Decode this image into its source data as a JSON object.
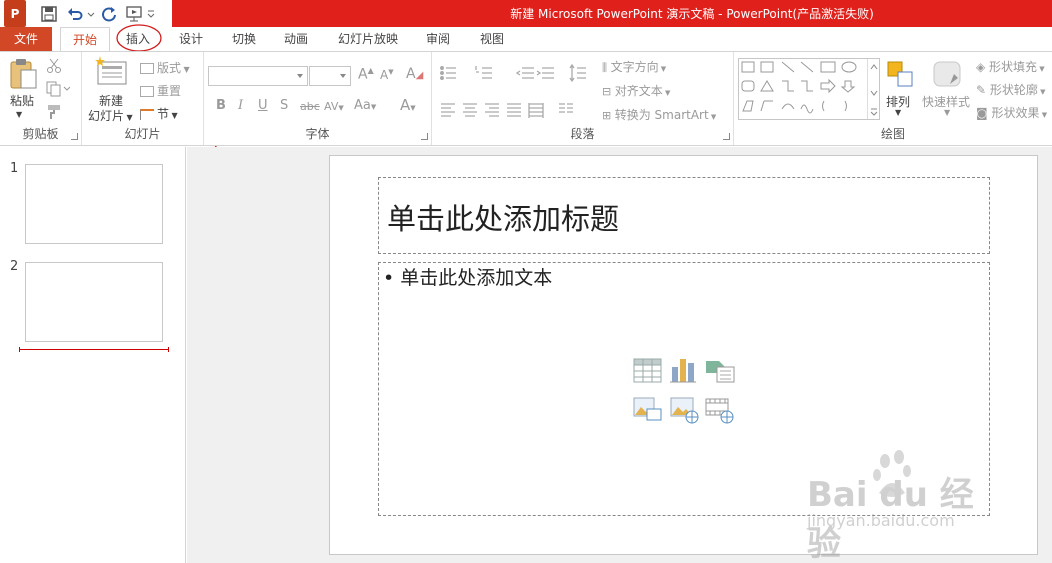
{
  "window": {
    "title": "新建 Microsoft PowerPoint 演示文稿 -  PowerPoint(产品激活失败)",
    "logo_letter": "P",
    "title_bar_color": "#e0201b"
  },
  "tabs": {
    "file": "文件",
    "home": "开始",
    "insert": "插入",
    "design": "设计",
    "transitions": "切换",
    "animations": "动画",
    "slideshow": "幻灯片放映",
    "review": "审阅",
    "view": "视图"
  },
  "ribbon": {
    "clipboard": {
      "label": "剪贴板",
      "paste": "粘贴"
    },
    "slides": {
      "label": "幻灯片",
      "new_slide_line1": "新建",
      "new_slide_line2": "幻灯片",
      "layout": "版式",
      "reset": "重置",
      "section": "节"
    },
    "font": {
      "label": "字体",
      "font_name": "",
      "font_size": ""
    },
    "paragraph": {
      "label": "段落",
      "text_direction": "文字方向",
      "align_text": "对齐文本",
      "convert_smartart": "转换为 SmartArt"
    },
    "drawing": {
      "label": "绘图",
      "arrange": "排列",
      "quick_styles": "快速样式",
      "shape_fill": "形状填充",
      "shape_outline": "形状轮廓",
      "shape_effects": "形状效果"
    }
  },
  "slides_panel": {
    "slides": [
      {
        "number": "1"
      },
      {
        "number": "2"
      }
    ]
  },
  "slide": {
    "title_placeholder": "单击此处添加标题",
    "body_placeholder": "• 单击此处添加文本"
  },
  "watermark": {
    "brand": "Bai du 经验",
    "url": "jingyan.baidu.com"
  },
  "colors": {
    "accent": "#d24726",
    "annotation": "#d11d1d"
  }
}
